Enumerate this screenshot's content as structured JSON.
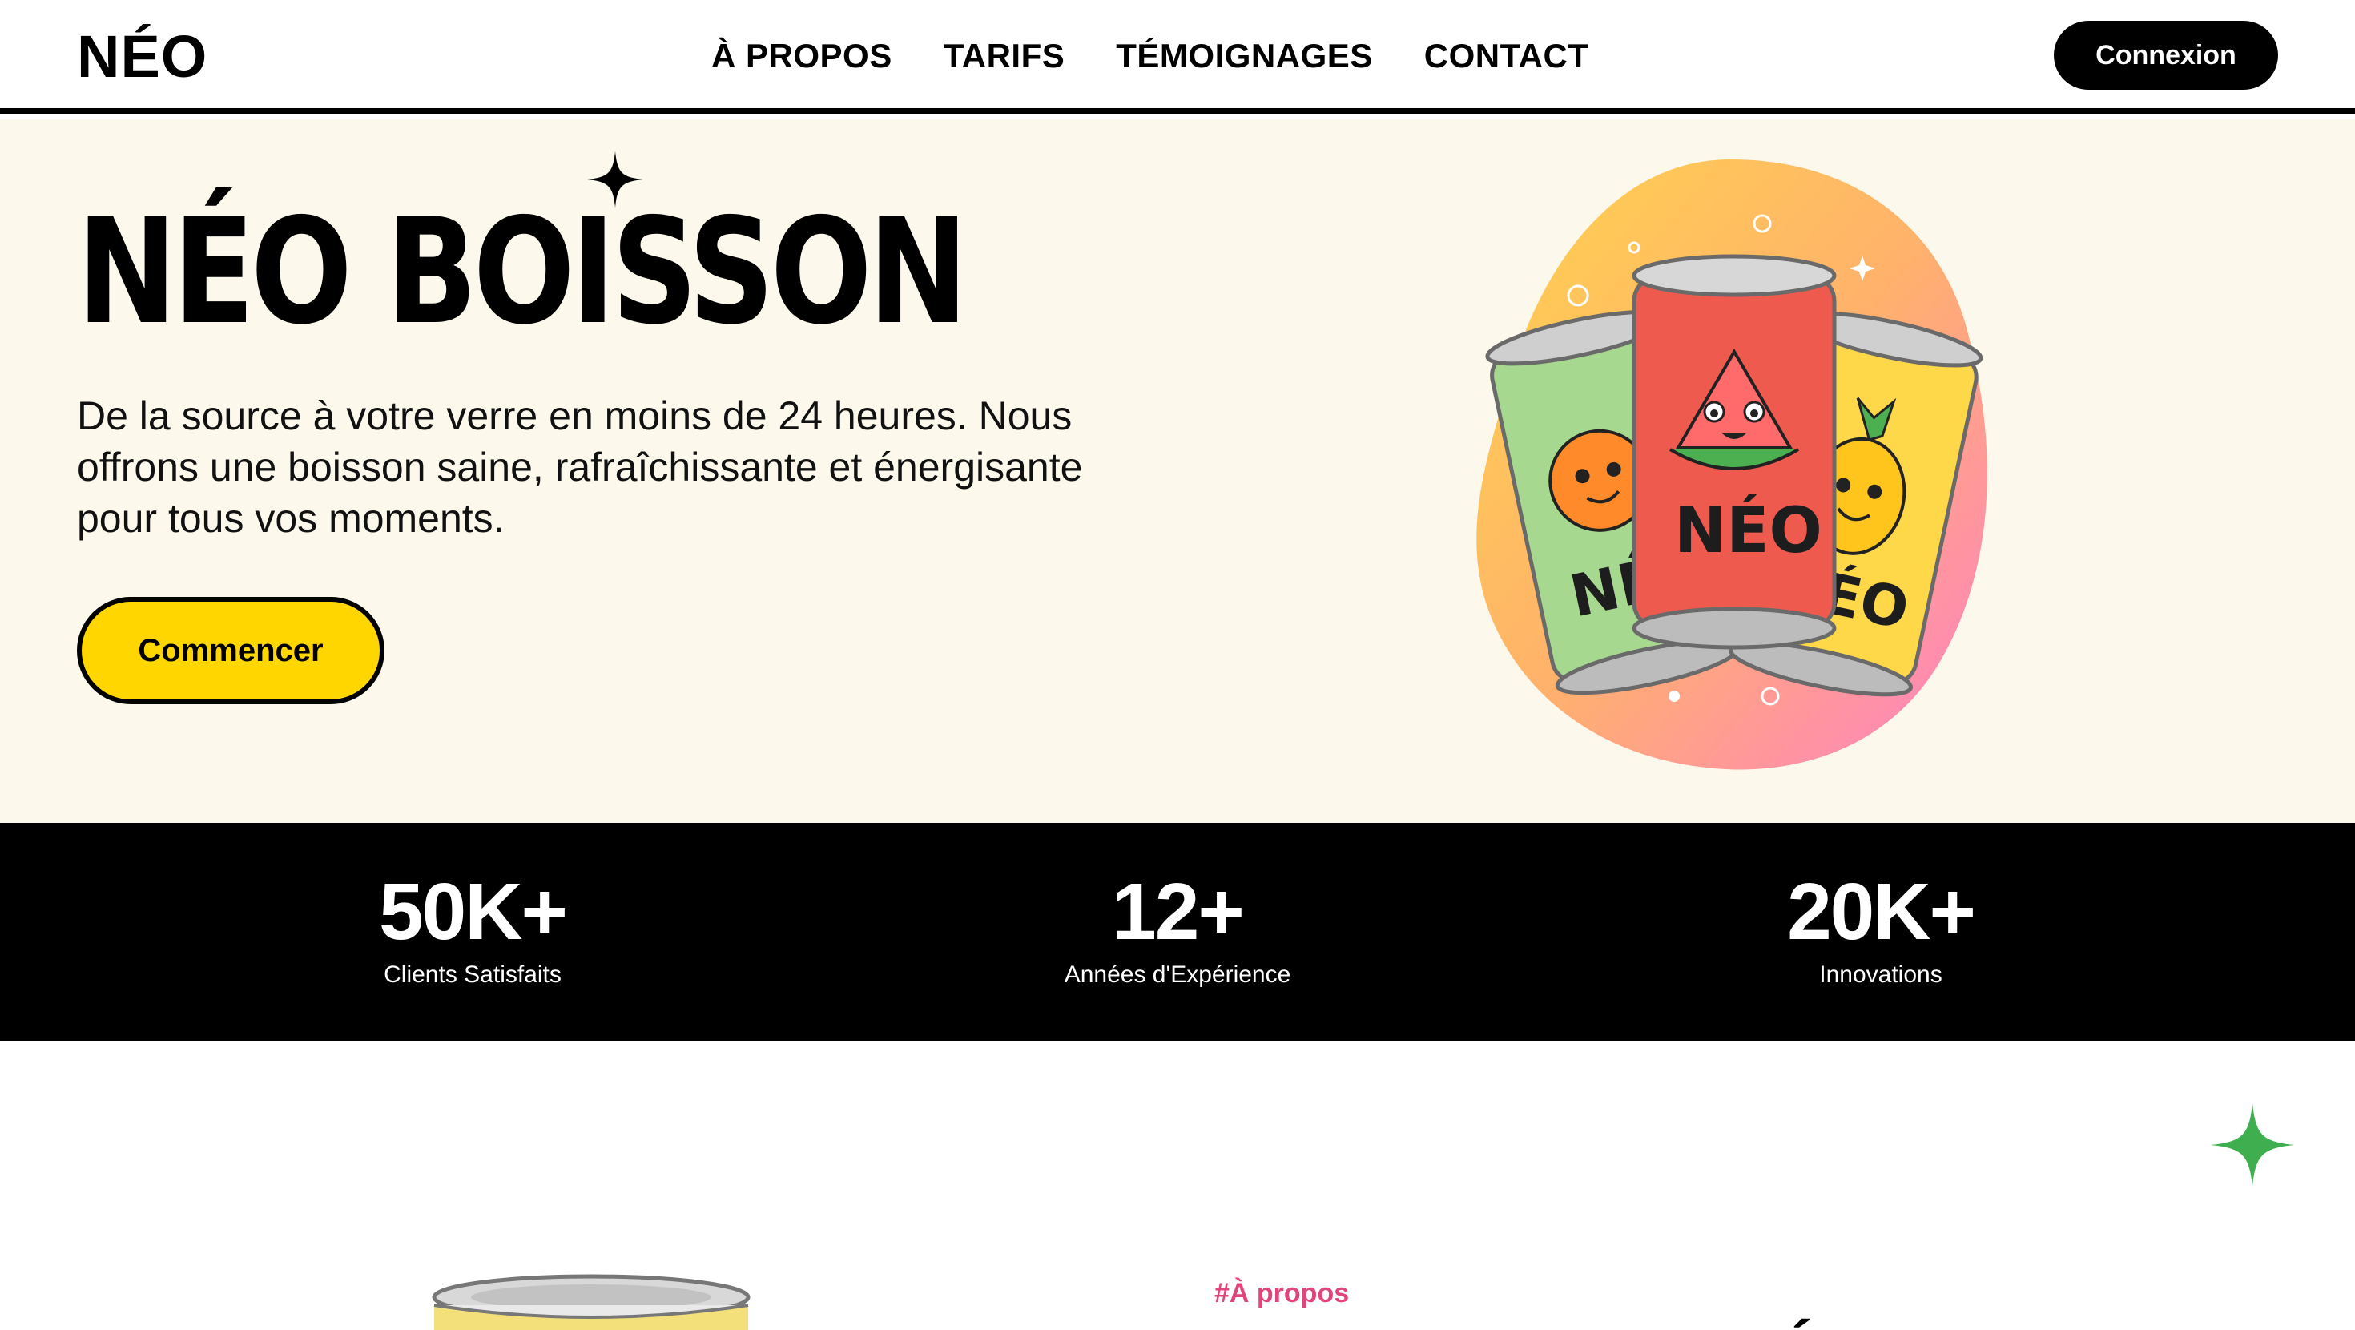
{
  "brand": {
    "logo": "NÉO"
  },
  "nav": {
    "items": [
      {
        "label": "À PROPOS"
      },
      {
        "label": "TARIFS"
      },
      {
        "label": "TÉMOIGNAGES"
      },
      {
        "label": "CONTACT"
      }
    ],
    "login_label": "Connexion"
  },
  "hero": {
    "title": "NÉO BOISSON",
    "description": "De la source à votre verre en moins de 24 heures. Nous offrons une boisson saine, rafraîchissante et énergisante pour tous vos moments.",
    "cta_label": "Commencer",
    "cta_color": "#ffd600",
    "background": "#fdf8ec",
    "illustration": {
      "can_labels": [
        "NÉO",
        "NÉO",
        "NÉO"
      ],
      "flavors": [
        "orange",
        "watermelon",
        "pineapple"
      ]
    }
  },
  "stats": [
    {
      "value": "50K+",
      "label": "Clients Satisfaits"
    },
    {
      "value": "12+",
      "label": "Années d'Expérience"
    },
    {
      "value": "20K+",
      "label": "Innovations"
    }
  ],
  "about": {
    "tag": "#À propos",
    "heading": "NOURRIR VOTRE ÉNERGIE",
    "tag_color": "#e0457b",
    "accent_star_color": "#3fae4f"
  },
  "icons": {
    "hero_sparkle": "sparkle-icon",
    "about_sparkle": "green-sparkle-icon"
  }
}
